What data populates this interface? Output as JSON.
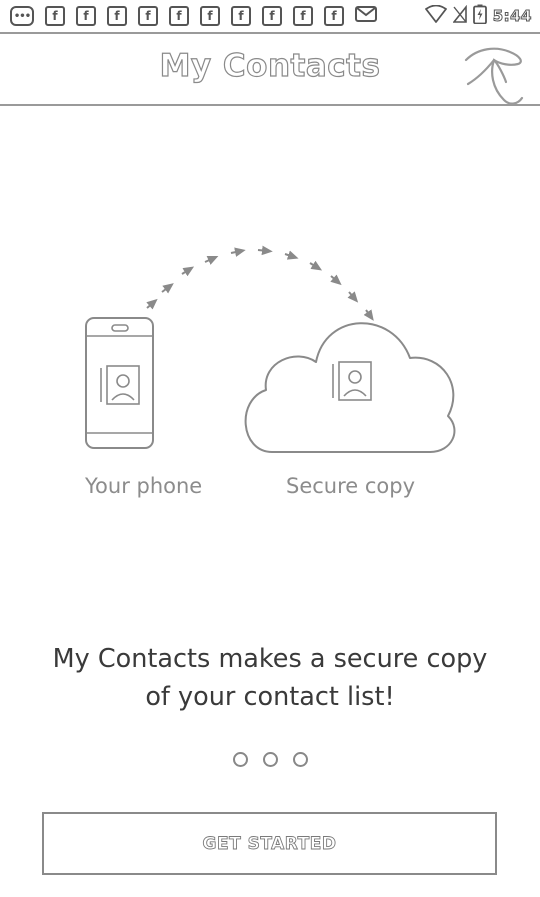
{
  "status_bar": {
    "notification_icons": [
      "more-icon",
      "facebook-icon",
      "facebook-icon",
      "facebook-icon",
      "facebook-icon",
      "facebook-icon",
      "facebook-icon",
      "facebook-icon",
      "facebook-icon",
      "facebook-icon",
      "facebook-icon",
      "gmail-icon"
    ],
    "facebook_glyph": "f",
    "more_glyph": "•••",
    "time": "5:44"
  },
  "header": {
    "title": "My Contacts"
  },
  "illustration": {
    "phone_label": "Your phone",
    "cloud_label": "Secure copy"
  },
  "onboarding": {
    "headline_line1": "My Contacts makes a secure copy",
    "headline_line2": "of your contact list!",
    "page_count": 3,
    "current_page": 1
  },
  "cta": {
    "label": "GET STARTED"
  }
}
